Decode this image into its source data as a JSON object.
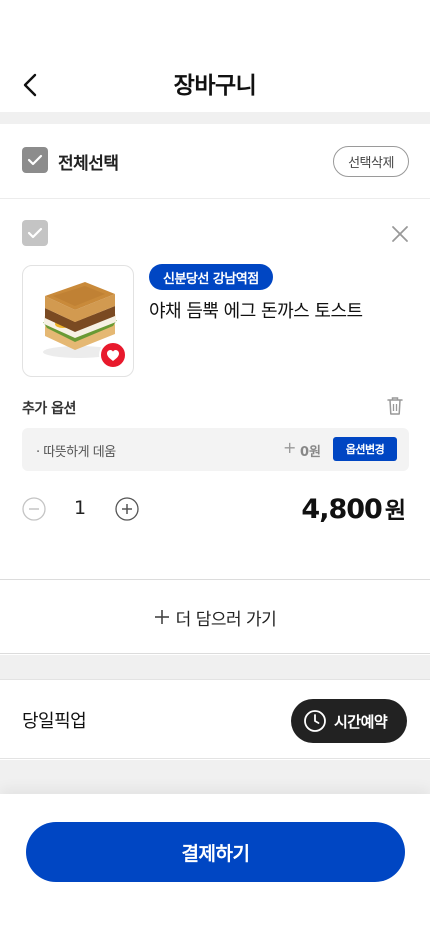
{
  "header": {
    "title": "장바구니",
    "back_icon": "chevron-left-icon"
  },
  "selection": {
    "select_all_label": "전체선택",
    "delete_selected_label": "선택삭제",
    "checked": true
  },
  "cart_item": {
    "checked": true,
    "store": "신분당선 강남역점",
    "name": "야채 듬뿍 에그 돈까스 토스트",
    "options_title": "추가 옵션",
    "option": {
      "text": "· 따뜻하게 데움",
      "price": "0원",
      "change_label": "옵션변경"
    },
    "quantity": "1",
    "price": "4,800",
    "currency": "원"
  },
  "add_more": {
    "label": "더 담으러 가기"
  },
  "pickup": {
    "label": "당일픽업",
    "reserve_label": "시간예약"
  },
  "checkout": {
    "pay_label": "결제하기"
  },
  "colors": {
    "brand_blue": "#0046c3",
    "heart_red": "#e8192c",
    "dark": "#222222",
    "checkbox_gray": "#8c8c8c"
  }
}
